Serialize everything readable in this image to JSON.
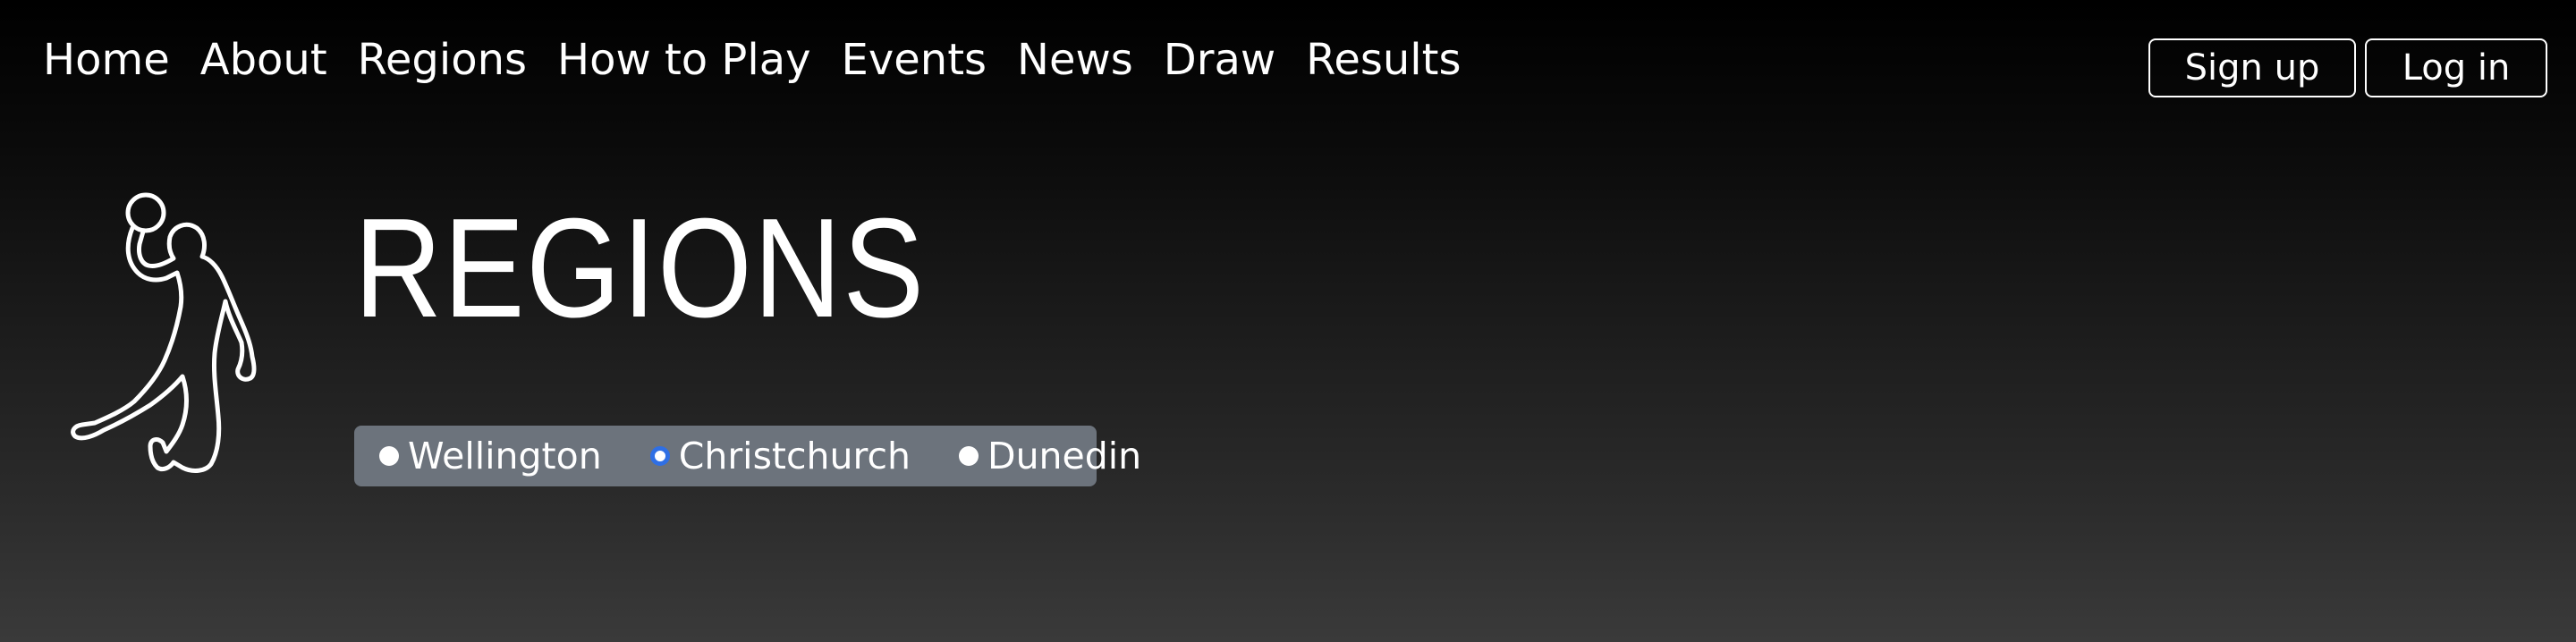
{
  "nav": {
    "items": [
      {
        "label": "Home"
      },
      {
        "label": "About"
      },
      {
        "label": "Regions"
      },
      {
        "label": "How to Play"
      },
      {
        "label": "Events"
      },
      {
        "label": "News"
      },
      {
        "label": "Draw"
      },
      {
        "label": "Results"
      }
    ]
  },
  "auth": {
    "signup_label": "Sign up",
    "login_label": "Log in"
  },
  "logo": {
    "icon": "handball-player-icon"
  },
  "page": {
    "title": "REGIONS"
  },
  "regions": {
    "selected": "Christchurch",
    "options": [
      {
        "label": "Wellington"
      },
      {
        "label": "Christchurch"
      },
      {
        "label": "Dunedin"
      }
    ]
  },
  "colors": {
    "background_top": "#000000",
    "background_bottom": "#3a3a3a",
    "region_bar": "#6c737c",
    "radio_selected": "#2f6fe4"
  }
}
